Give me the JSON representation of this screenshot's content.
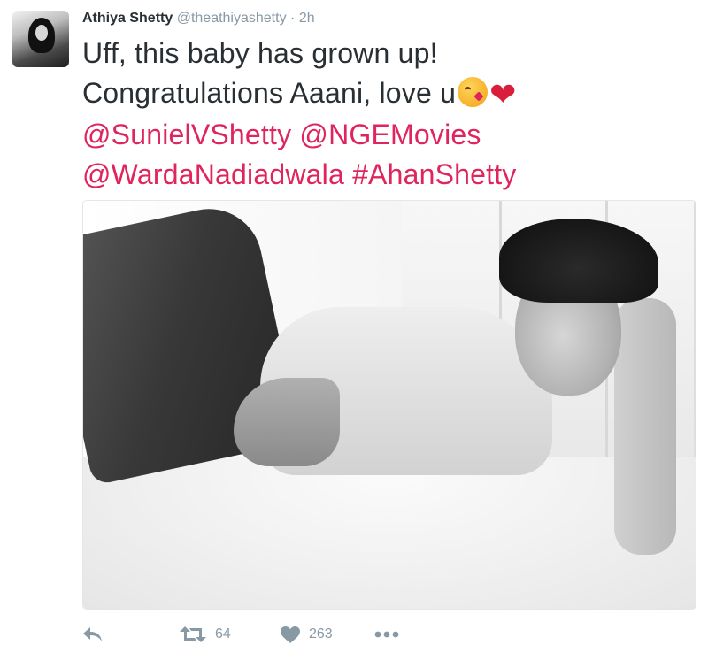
{
  "author": {
    "name": "Athiya Shetty",
    "handle": "@theathiyashetty",
    "separator": "·",
    "time": "2h"
  },
  "tweet": {
    "line1": "Uff, this baby has grown up!",
    "line2": "Congratulations Aaani, love u",
    "mention_suniel": "@SunielVShetty",
    "mention_nge": "@NGEMovies",
    "mention_warda": "@WardaNadiadwala",
    "hashtag": "#AhanShetty",
    "emoji": [
      "kissing-face-wink-emoji",
      "red-heart-emoji"
    ],
    "heart_glyph": "❤"
  },
  "actions": {
    "retweet_count": "64",
    "like_count": "263",
    "icons": [
      "reply-icon",
      "retweet-icon",
      "like-icon",
      "more-icon"
    ]
  },
  "colors": {
    "link": "#e0245e",
    "muted": "#8899a6",
    "text": "#292f33"
  }
}
